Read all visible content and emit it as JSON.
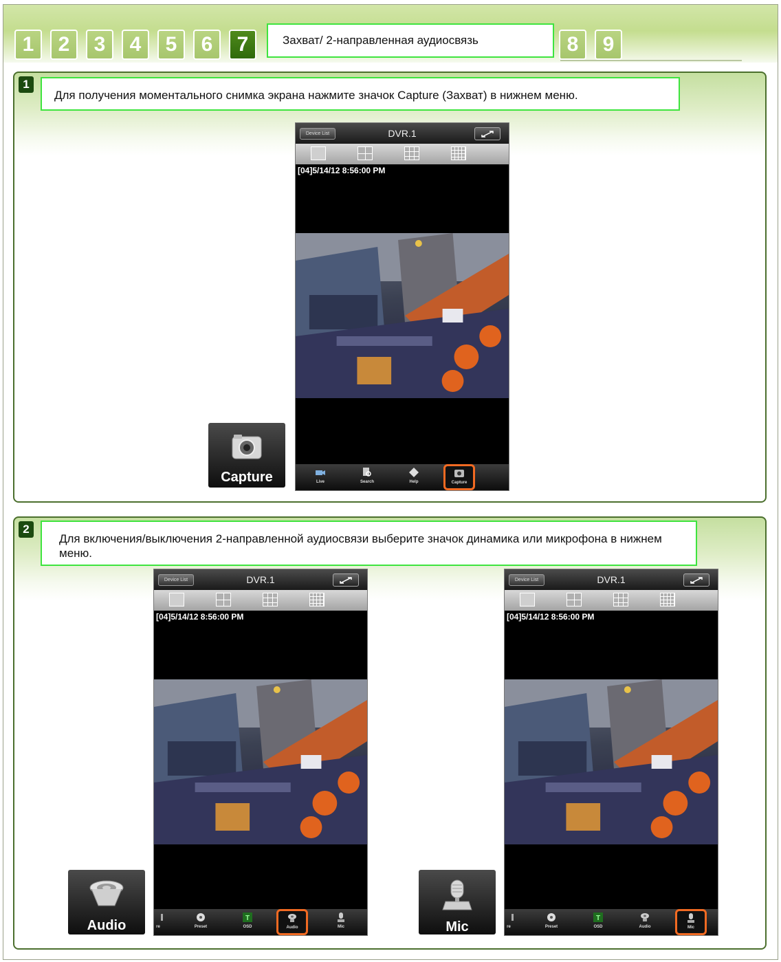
{
  "tabs": [
    {
      "label": "1",
      "active": false
    },
    {
      "label": "2",
      "active": false
    },
    {
      "label": "3",
      "active": false
    },
    {
      "label": "4",
      "active": false
    },
    {
      "label": "5",
      "active": false
    },
    {
      "label": "6",
      "active": false
    },
    {
      "label": "7",
      "active": true
    },
    {
      "label": "8",
      "active": false
    },
    {
      "label": "9",
      "active": false
    }
  ],
  "header_title": "Захват/ 2-направленная аудиосвязь",
  "steps": [
    {
      "number": "1",
      "instruction": "Для получения моментального снимка экрана нажмите значок Capture (Захват) в нижнем меню.",
      "callout_label": "Capture",
      "callout_icon": "camera-icon"
    },
    {
      "number": "2",
      "instruction": "Для включения/выключения 2-направленной аудиосвязи выберите значок динамика или микрофона в нижнем меню.",
      "callout_left_label": "Audio",
      "callout_left_icon": "speaker-icon",
      "callout_right_label": "Mic",
      "callout_right_icon": "microphone-icon"
    }
  ],
  "phone": {
    "device_list_label": "Device List",
    "title": "DVR.1",
    "timestamp": "[04]5/14/12 8:56:00 PM",
    "toolbar_1": [
      "Live",
      "Search",
      "Help",
      "Capture"
    ],
    "toolbar_2": [
      "re",
      "Preset",
      "OSD",
      "Audio",
      "Mic"
    ]
  },
  "colors": {
    "highlight_border": "#3ee43e",
    "toolbar_highlight": "#f26a22",
    "panel_border": "#4b6f2d",
    "tab_active": "#2f6a0b"
  }
}
